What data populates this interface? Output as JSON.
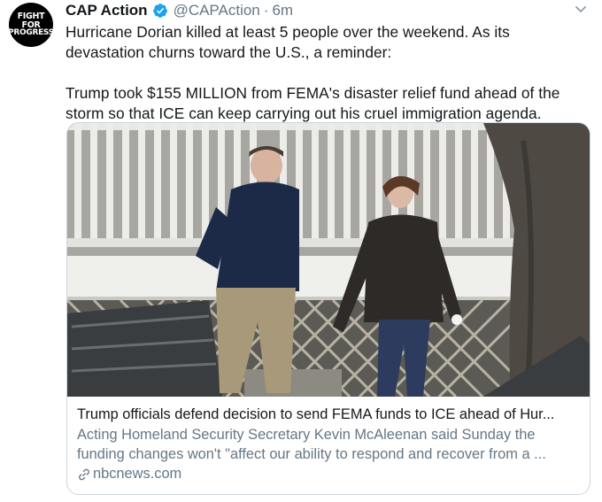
{
  "tweet": {
    "avatar": {
      "line1": "FIGHT FOR",
      "line2": "PROGRESS"
    },
    "author_name": "CAP Action",
    "handle": "@CAPAction",
    "separator": "·",
    "time": "6m",
    "paragraph1": "Hurricane Dorian killed at least 5 people over the weekend. As its devastation churns toward the U.S., a reminder:",
    "paragraph2": "Trump took $155 MILLION from FEMA's disaster relief fund ahead of the storm so that ICE can keep carrying out his cruel immigration agenda."
  },
  "card": {
    "title": "Trump officials defend decision to send FEMA funds to ICE ahead of Hur...",
    "description": "Acting Homeland Security Secretary Kevin McAleenan said Sunday the funding changes won't \"affect our ability to respond and recover from a ...",
    "domain": "nbcnews.com"
  },
  "icons": {
    "verified": "verified-badge-icon",
    "caret": "chevron-down-icon",
    "link": "link-icon"
  },
  "colors": {
    "text": "#14171a",
    "secondary": "#657786",
    "verified": "#1da1f2",
    "border": "#ccd6dd"
  }
}
